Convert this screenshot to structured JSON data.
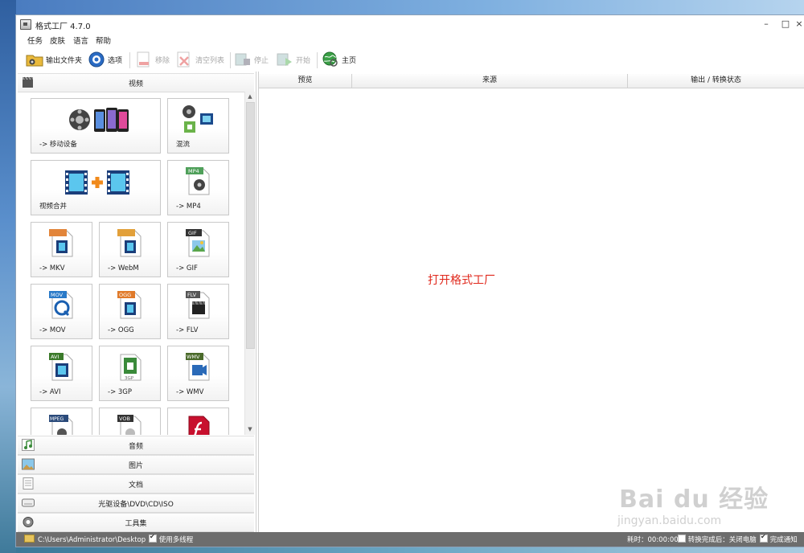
{
  "window": {
    "title": "格式工厂 4.7.0",
    "minimize": "–",
    "maximize": "□",
    "close": "×"
  },
  "menu": [
    "任务",
    "皮肤",
    "语言",
    "帮助"
  ],
  "toolbar": {
    "output_folder": "输出文件夹",
    "options": "选项",
    "remove": "移除",
    "clear_list": "清空列表",
    "stop": "停止",
    "start": "开始",
    "home": "主页"
  },
  "categories": {
    "video": "视频",
    "audio": "音频",
    "image": "图片",
    "document": "文档",
    "optical": "光驱设备\\DVD\\CD\\ISO",
    "toolbox": "工具集"
  },
  "tiles": {
    "mobile": "-> 移动设备",
    "mux": "混流",
    "join": "视频合并",
    "mp4": "-> MP4",
    "mkv": "-> MKV",
    "webm": "-> WebM",
    "gif": "-> GIF",
    "mov": "-> MOV",
    "ogg": "-> OGG",
    "flv": "-> FLV",
    "avi": "-> AVI",
    "3gp": "-> 3GP",
    "wmv": "-> WMV"
  },
  "tile_badges": {
    "mp4": "MP4",
    "gif": "GIF",
    "mov": "MOV",
    "ogg": "OGG",
    "flv": "FLV",
    "avi": "AVI",
    "3gp": "3GP",
    "wmv": "WMV",
    "mpeg": "MPEG",
    "vob": "VOB"
  },
  "columns": {
    "preview": "预览",
    "source": "来源",
    "status": "输出 / 转换状态"
  },
  "center_message": "打开格式工厂",
  "statusbar": {
    "path": "C:\\Users\\Administrator\\Desktop",
    "multithread": "使用多线程",
    "elapsed": "耗时：00:00:00",
    "after_done": "转换完成后：关闭电脑",
    "notify": "完成通知"
  },
  "watermark": {
    "brand": "Bai du 经验",
    "site": "jingyan.baidu.com"
  },
  "colors": {
    "message_red": "#e0281c",
    "statusbar_bg": "#6d6d6d"
  }
}
